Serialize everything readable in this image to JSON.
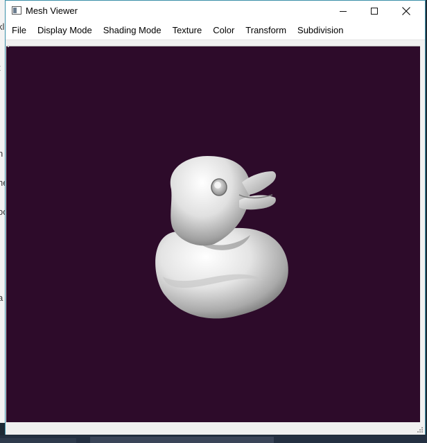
{
  "window": {
    "title": "Mesh Viewer",
    "icon": "app-window-icon",
    "controls": [
      "minimize-icon",
      "maximize-icon",
      "close-icon"
    ]
  },
  "menu": {
    "items": [
      "File",
      "Display Mode",
      "Shading Mode",
      "Texture",
      "Color",
      "Transform",
      "Subdivision"
    ]
  },
  "viewport": {
    "background": "#2d0b2a",
    "model": "rubber duck mesh",
    "model_color": "#d8d8d8"
  },
  "background_snippets": [
    "kl",
    "t",
    "n",
    "he",
    "oc",
    "a"
  ]
}
